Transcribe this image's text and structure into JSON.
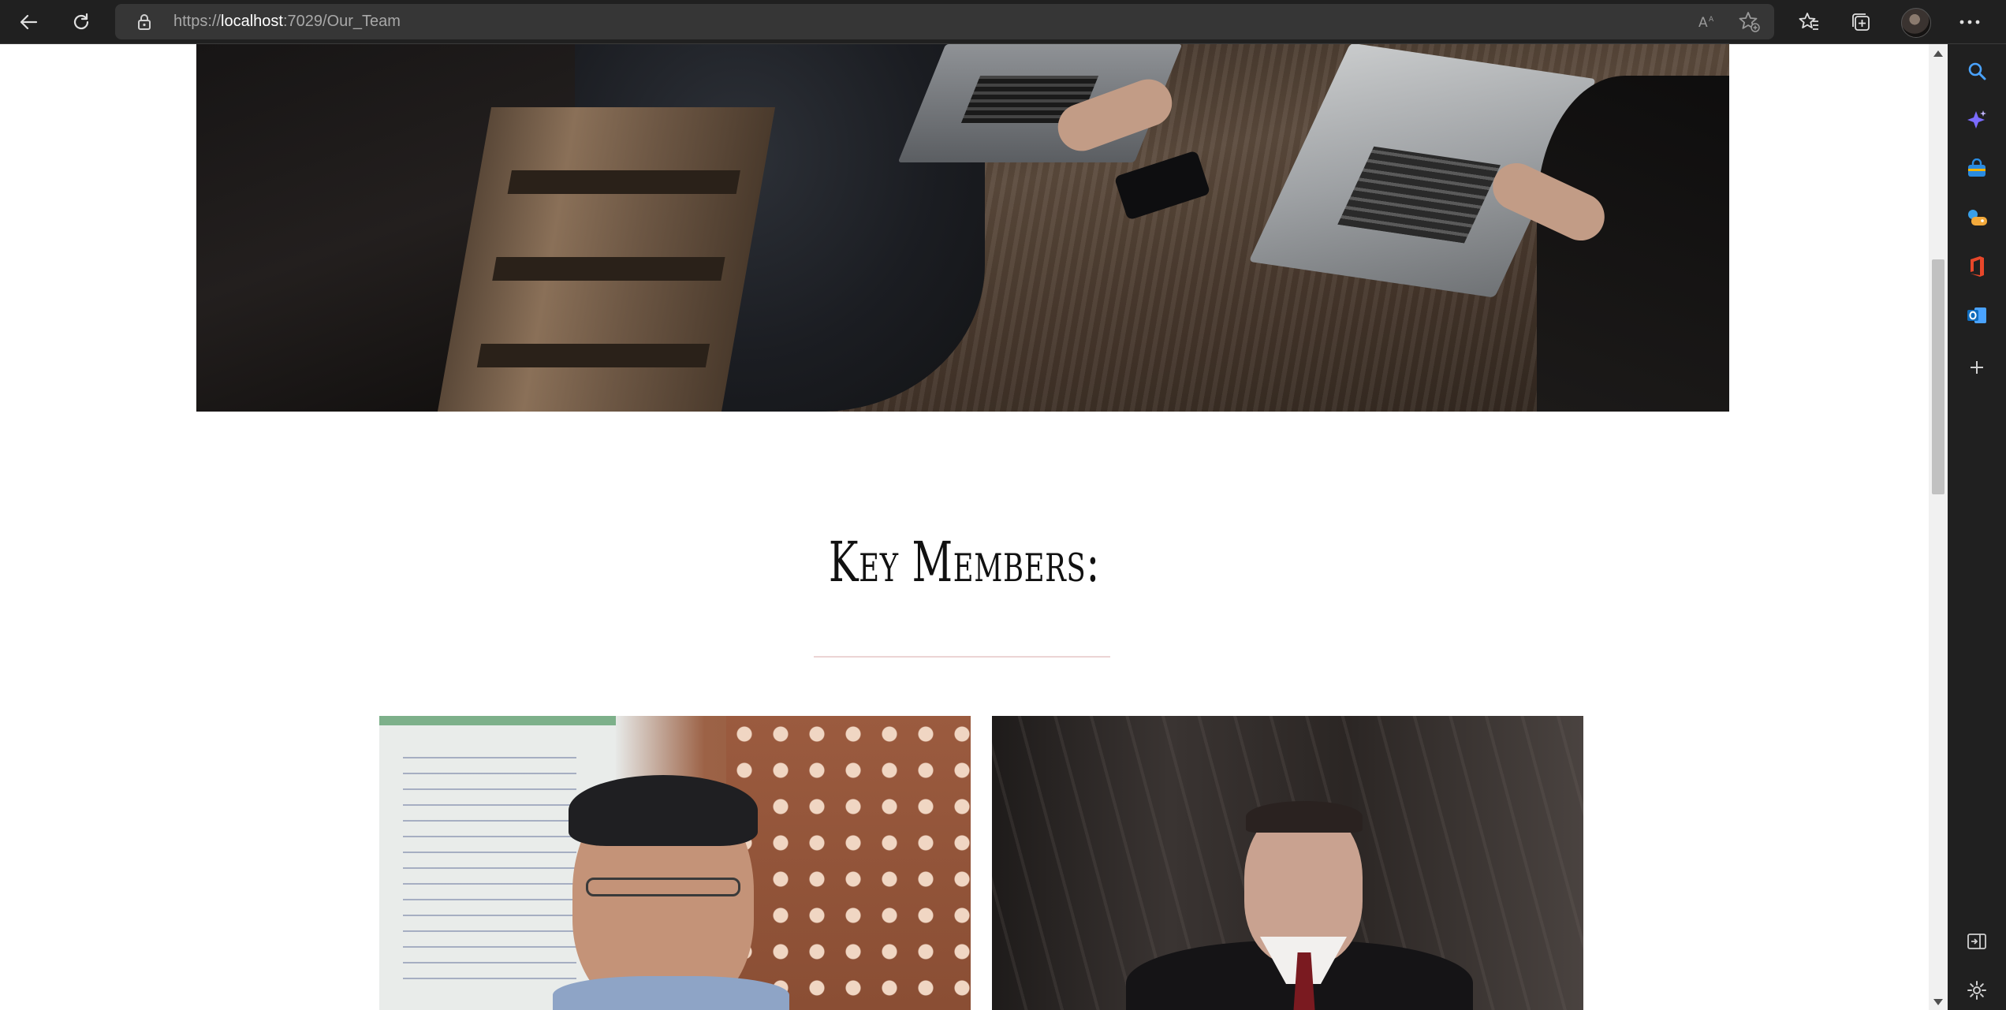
{
  "browser": {
    "url_prefix": "https://",
    "url_host": "localhost",
    "url_rest": ":7029/Our_Team",
    "icons": {
      "back": "back-arrow-icon",
      "refresh": "refresh-icon",
      "lock": "lock-icon",
      "read_aloud": "read-aloud-icon",
      "add_favorite": "add-favorite-icon",
      "favorites": "favorites-icon",
      "collections": "collections-icon",
      "profile": "profile-avatar",
      "more": "more-icon"
    }
  },
  "sidebar": {
    "items": [
      "search-icon",
      "copilot-icon",
      "shopping-icon",
      "games-icon",
      "office-icon",
      "outlook-icon",
      "add-icon",
      "split-screen-icon",
      "settings-icon"
    ]
  },
  "page": {
    "hero_image": "team-working-at-table-photo",
    "heading": "Key Members:",
    "members": [
      {
        "photo": "member-photo-glasses"
      },
      {
        "photo": "member-photo-suit"
      }
    ]
  },
  "colors": {
    "browser_bg": "#202020",
    "address_bg": "#363636",
    "divider": "#ecd4d4",
    "heading": "#111111"
  }
}
